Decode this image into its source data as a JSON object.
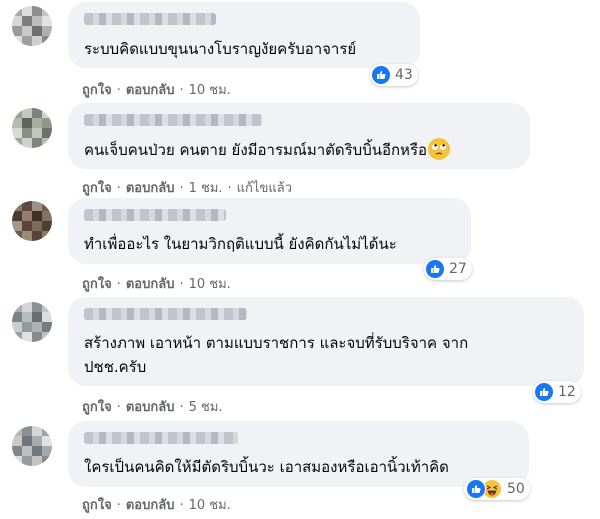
{
  "actions": {
    "like_label": "ถูกใจ",
    "reply_label": "ตอบกลับ",
    "separator": "·"
  },
  "comments": [
    {
      "text": "ระบบคิดแบบขุนนางโบราญงัยครับอาจารย์",
      "reaction_count": "43",
      "time": "10 ชม.",
      "edited": ""
    },
    {
      "text": "คนเจ็บคนป่วย คนตาย ยังมีอารมณ์มาตัดริบบิ้นอีกหรือ",
      "inline_emoji": "face-with-rolling-eyes-icon",
      "reaction_count": "",
      "time": "1 ชม.",
      "edited": "แก้ไขแล้ว"
    },
    {
      "text": "ทำเพื่ออะไร ในยามวิกฤติแบบนี้ ยังคิดกันไม่ได้นะ",
      "reaction_count": "27",
      "time": "10 ชม.",
      "edited": ""
    },
    {
      "text_line1": "สร้างภาพ เอาหน้า ตามแบบราชการ และจบที่รับบริจาค จาก",
      "text_line2": "ปชช.ครับ",
      "reaction_count": "12",
      "time": "5 ชม.",
      "edited": ""
    },
    {
      "text": "ใครเป็นคนคิดให้มีตัดริบบิ้นวะ เอาสมองหรือเอานิ้วเท้าคิด",
      "reaction_count": "50",
      "time": "10 ชม.",
      "edited": ""
    }
  ],
  "colors": {
    "bubble": "#f0f2f5",
    "meta_text": "#65676b",
    "like_blue": "#1877f2",
    "haha_yellow": "#f7c33a"
  }
}
